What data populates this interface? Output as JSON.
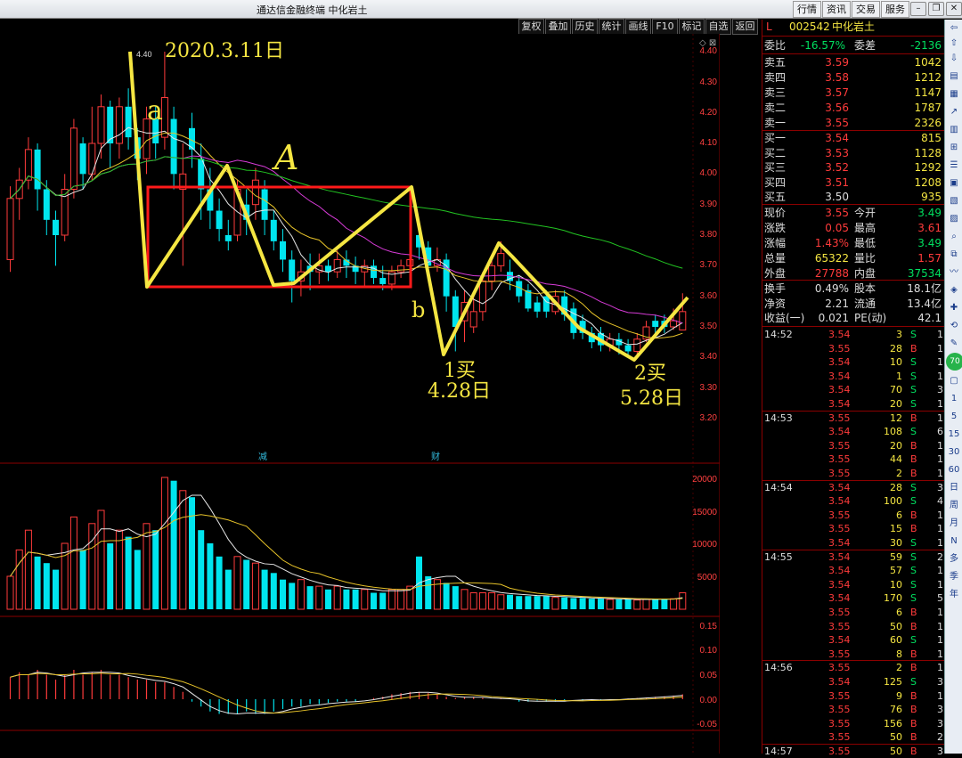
{
  "window": {
    "title": "通达信金融终端  中化岩土",
    "menu": [
      "行情",
      "资讯",
      "交易",
      "服务"
    ]
  },
  "chart_toolbar": [
    "复权",
    "叠加",
    "历史",
    "统计",
    "画线",
    "F10",
    "标记",
    "自选",
    "返回"
  ],
  "price_axis": [
    "4.40",
    "4.30",
    "4.20",
    "4.10",
    "4.00",
    "3.90",
    "3.80",
    "3.70",
    "3.60",
    "3.50",
    "3.40",
    "3.30",
    "3.20"
  ],
  "volume_axis": [
    "20000",
    "15000",
    "10000",
    "5000"
  ],
  "macd_axis": [
    "0.15",
    "0.10",
    "0.05",
    "0.00",
    "-0.05"
  ],
  "chart_labels": {
    "high_mark": "4.40",
    "marker_jian": "减",
    "marker_cai": "财"
  },
  "annotations": {
    "date_top": "2020.3.11日",
    "a": "a",
    "box": "A",
    "b": "b",
    "buy1": "1买",
    "date1": "4.28日",
    "buy2": "2买",
    "date2": "5.28日"
  },
  "stock": {
    "flag": "L",
    "code": "002542",
    "name": "中化岩土"
  },
  "quote": {
    "weibi_label": "委比",
    "weibi": "-16.57%",
    "weicha_label": "委差",
    "weicha": "-2136",
    "asks": [
      {
        "label": "卖五",
        "price": "3.59",
        "vol": "1042"
      },
      {
        "label": "卖四",
        "price": "3.58",
        "vol": "1212"
      },
      {
        "label": "卖三",
        "price": "3.57",
        "vol": "1147"
      },
      {
        "label": "卖二",
        "price": "3.56",
        "vol": "1787"
      },
      {
        "label": "卖一",
        "price": "3.55",
        "vol": "2326"
      }
    ],
    "bids": [
      {
        "label": "买一",
        "price": "3.54",
        "vol": "815"
      },
      {
        "label": "买二",
        "price": "3.53",
        "vol": "1128"
      },
      {
        "label": "买三",
        "price": "3.52",
        "vol": "1292"
      },
      {
        "label": "买四",
        "price": "3.51",
        "vol": "1208"
      },
      {
        "label": "买五",
        "price": "3.50",
        "vol": "935"
      }
    ],
    "stats": [
      {
        "l1": "现价",
        "v1": "3.55",
        "l2": "今开",
        "v2": "3.49"
      },
      {
        "l1": "涨跌",
        "v1": "0.05",
        "l2": "最高",
        "v2": "3.61"
      },
      {
        "l1": "涨幅",
        "v1": "1.43%",
        "l2": "最低",
        "v2": "3.49"
      },
      {
        "l1": "总量",
        "v1": "65322",
        "l2": "量比",
        "v2": "1.57"
      },
      {
        "l1": "外盘",
        "v1": "27788",
        "l2": "内盘",
        "v2": "37534"
      }
    ],
    "stats2": [
      {
        "l1": "换手",
        "v1": "0.49%",
        "l2": "股本",
        "v2": "18.1亿"
      },
      {
        "l1": "净资",
        "v1": "2.21",
        "l2": "流通",
        "v2": "13.4亿"
      },
      {
        "l1": "收益(一)",
        "v1": "0.021",
        "l2": "PE(动)",
        "v2": "42.1"
      }
    ]
  },
  "ticks": [
    {
      "time": "14:52",
      "price": "3.54",
      "vol": "3",
      "side": "S",
      "n": "1"
    },
    {
      "time": "",
      "price": "3.55",
      "vol": "28",
      "side": "B",
      "n": "1"
    },
    {
      "time": "",
      "price": "3.54",
      "vol": "10",
      "side": "S",
      "n": "1"
    },
    {
      "time": "",
      "price": "3.54",
      "vol": "1",
      "side": "S",
      "n": "1"
    },
    {
      "time": "",
      "price": "3.54",
      "vol": "70",
      "side": "S",
      "n": "3"
    },
    {
      "time": "",
      "price": "3.54",
      "vol": "20",
      "side": "S",
      "n": "1"
    },
    {
      "time": "14:53",
      "price": "3.55",
      "vol": "12",
      "side": "B",
      "n": "1"
    },
    {
      "time": "",
      "price": "3.54",
      "vol": "108",
      "side": "S",
      "n": "6"
    },
    {
      "time": "",
      "price": "3.55",
      "vol": "20",
      "side": "B",
      "n": "1"
    },
    {
      "time": "",
      "price": "3.55",
      "vol": "44",
      "side": "B",
      "n": "1"
    },
    {
      "time": "",
      "price": "3.55",
      "vol": "2",
      "side": "B",
      "n": "1"
    },
    {
      "time": "14:54",
      "price": "3.54",
      "vol": "28",
      "side": "S",
      "n": "3"
    },
    {
      "time": "",
      "price": "3.54",
      "vol": "100",
      "side": "S",
      "n": "4"
    },
    {
      "time": "",
      "price": "3.55",
      "vol": "6",
      "side": "B",
      "n": "1"
    },
    {
      "time": "",
      "price": "3.55",
      "vol": "15",
      "side": "B",
      "n": "1"
    },
    {
      "time": "",
      "price": "3.54",
      "vol": "30",
      "side": "S",
      "n": "1"
    },
    {
      "time": "14:55",
      "price": "3.54",
      "vol": "59",
      "side": "S",
      "n": "2"
    },
    {
      "time": "",
      "price": "3.54",
      "vol": "57",
      "side": "S",
      "n": "1"
    },
    {
      "time": "",
      "price": "3.54",
      "vol": "10",
      "side": "S",
      "n": "1"
    },
    {
      "time": "",
      "price": "3.54",
      "vol": "170",
      "side": "S",
      "n": "5"
    },
    {
      "time": "",
      "price": "3.55",
      "vol": "6",
      "side": "B",
      "n": "1"
    },
    {
      "time": "",
      "price": "3.55",
      "vol": "50",
      "side": "B",
      "n": "1"
    },
    {
      "time": "",
      "price": "3.54",
      "vol": "60",
      "side": "S",
      "n": "1"
    },
    {
      "time": "",
      "price": "3.55",
      "vol": "8",
      "side": "B",
      "n": "1"
    },
    {
      "time": "14:56",
      "price": "3.55",
      "vol": "2",
      "side": "B",
      "n": "1"
    },
    {
      "time": "",
      "price": "3.54",
      "vol": "125",
      "side": "S",
      "n": "3"
    },
    {
      "time": "",
      "price": "3.55",
      "vol": "9",
      "side": "B",
      "n": "1"
    },
    {
      "time": "",
      "price": "3.55",
      "vol": "76",
      "side": "B",
      "n": "3"
    },
    {
      "time": "",
      "price": "3.55",
      "vol": "156",
      "side": "B",
      "n": "3"
    },
    {
      "time": "",
      "price": "3.55",
      "vol": "50",
      "side": "B",
      "n": "2"
    },
    {
      "time": "14:57",
      "price": "3.55",
      "vol": "50",
      "side": "B",
      "n": "3"
    }
  ],
  "side_toolbar": [
    "1",
    "5",
    "15",
    "30",
    "60",
    "日",
    "周",
    "月",
    "N",
    "多",
    "季",
    "年"
  ],
  "side_badge": "70",
  "colors": {
    "up": "#ff3b3b",
    "down": "#00e5ee",
    "accent": "#f5e642",
    "panel_border": "#8b0000"
  },
  "chart_data": {
    "type": "candlestick",
    "ylim": [
      3.15,
      4.45
    ],
    "candles": [
      {
        "o": 3.72,
        "c": 3.92,
        "h": 3.96,
        "l": 3.68
      },
      {
        "o": 3.92,
        "c": 3.98,
        "h": 4.02,
        "l": 3.85
      },
      {
        "o": 3.98,
        "c": 4.08,
        "h": 4.12,
        "l": 3.95
      },
      {
        "o": 4.08,
        "c": 3.95,
        "h": 4.1,
        "l": 3.88
      },
      {
        "o": 3.95,
        "c": 3.85,
        "h": 3.98,
        "l": 3.8
      },
      {
        "o": 3.85,
        "c": 3.8,
        "h": 3.88,
        "l": 3.7
      },
      {
        "o": 3.8,
        "c": 3.95,
        "h": 4.0,
        "l": 3.78
      },
      {
        "o": 3.95,
        "c": 4.15,
        "h": 4.18,
        "l": 3.92
      },
      {
        "o": 4.1,
        "c": 4.0,
        "h": 4.12,
        "l": 3.95
      },
      {
        "o": 4.0,
        "c": 4.1,
        "h": 4.22,
        "l": 3.98
      },
      {
        "o": 4.1,
        "c": 4.22,
        "h": 4.26,
        "l": 4.05
      },
      {
        "o": 4.22,
        "c": 4.1,
        "h": 4.24,
        "l": 4.02
      },
      {
        "o": 4.1,
        "c": 4.22,
        "h": 4.25,
        "l": 4.05
      },
      {
        "o": 4.22,
        "c": 4.12,
        "h": 4.28,
        "l": 4.08
      },
      {
        "o": 4.12,
        "c": 4.05,
        "h": 4.15,
        "l": 3.98
      },
      {
        "o": 4.05,
        "c": 4.18,
        "h": 4.22,
        "l": 4.0
      },
      {
        "o": 4.18,
        "c": 4.1,
        "h": 4.22,
        "l": 4.05
      },
      {
        "o": 4.12,
        "c": 4.25,
        "h": 4.4,
        "l": 4.08
      },
      {
        "o": 4.18,
        "c": 4.0,
        "h": 4.22,
        "l": 3.95
      },
      {
        "o": 3.95,
        "c": 4.0,
        "h": 4.1,
        "l": 3.7
      },
      {
        "o": 4.15,
        "c": 4.08,
        "h": 4.2,
        "l": 4.02
      },
      {
        "o": 4.05,
        "c": 3.95,
        "h": 4.1,
        "l": 3.85
      },
      {
        "o": 3.95,
        "c": 3.88,
        "h": 4.02,
        "l": 3.82
      },
      {
        "o": 3.88,
        "c": 3.82,
        "h": 3.92,
        "l": 3.78
      },
      {
        "o": 3.8,
        "c": 3.78,
        "h": 3.85,
        "l": 3.75
      },
      {
        "o": 3.8,
        "c": 3.95,
        "h": 3.98,
        "l": 3.78
      },
      {
        "o": 3.9,
        "c": 3.85,
        "h": 3.95,
        "l": 3.8
      },
      {
        "o": 3.9,
        "c": 3.98,
        "h": 4.02,
        "l": 3.85
      },
      {
        "o": 3.95,
        "c": 3.85,
        "h": 3.98,
        "l": 3.8
      },
      {
        "o": 3.85,
        "c": 3.78,
        "h": 3.88,
        "l": 3.75
      },
      {
        "o": 3.78,
        "c": 3.72,
        "h": 3.82,
        "l": 3.68
      },
      {
        "o": 3.72,
        "c": 3.65,
        "h": 3.75,
        "l": 3.58
      },
      {
        "o": 3.65,
        "c": 3.68,
        "h": 3.72,
        "l": 3.6
      },
      {
        "o": 3.7,
        "c": 3.68,
        "h": 3.74,
        "l": 3.62
      },
      {
        "o": 3.68,
        "c": 3.7,
        "h": 3.74,
        "l": 3.64
      },
      {
        "o": 3.7,
        "c": 3.68,
        "h": 3.72,
        "l": 3.65
      },
      {
        "o": 3.68,
        "c": 3.72,
        "h": 3.75,
        "l": 3.66
      },
      {
        "o": 3.72,
        "c": 3.7,
        "h": 3.75,
        "l": 3.66
      },
      {
        "o": 3.7,
        "c": 3.68,
        "h": 3.73,
        "l": 3.64
      },
      {
        "o": 3.68,
        "c": 3.7,
        "h": 3.72,
        "l": 3.63
      },
      {
        "o": 3.7,
        "c": 3.66,
        "h": 3.72,
        "l": 3.64
      },
      {
        "o": 3.66,
        "c": 3.64,
        "h": 3.7,
        "l": 3.62
      },
      {
        "o": 3.64,
        "c": 3.68,
        "h": 3.7,
        "l": 3.62
      },
      {
        "o": 3.68,
        "c": 3.7,
        "h": 3.72,
        "l": 3.66
      },
      {
        "o": 3.7,
        "c": 3.72,
        "h": 3.76,
        "l": 3.68
      },
      {
        "o": 3.8,
        "c": 3.76,
        "h": 3.84,
        "l": 3.72
      },
      {
        "o": 3.76,
        "c": 3.7,
        "h": 3.78,
        "l": 3.66
      },
      {
        "o": 3.7,
        "c": 3.72,
        "h": 3.76,
        "l": 3.68
      },
      {
        "o": 3.72,
        "c": 3.6,
        "h": 3.74,
        "l": 3.55
      },
      {
        "o": 3.6,
        "c": 3.5,
        "h": 3.62,
        "l": 3.42
      },
      {
        "o": 3.52,
        "c": 3.58,
        "h": 3.62,
        "l": 3.45
      },
      {
        "o": 3.5,
        "c": 3.55,
        "h": 3.6,
        "l": 3.48
      },
      {
        "o": 3.55,
        "c": 3.65,
        "h": 3.68,
        "l": 3.52
      },
      {
        "o": 3.65,
        "c": 3.7,
        "h": 3.72,
        "l": 3.62
      },
      {
        "o": 3.7,
        "c": 3.74,
        "h": 3.78,
        "l": 3.68
      },
      {
        "o": 3.68,
        "c": 3.65,
        "h": 3.72,
        "l": 3.62
      },
      {
        "o": 3.65,
        "c": 3.6,
        "h": 3.67,
        "l": 3.58
      },
      {
        "o": 3.62,
        "c": 3.56,
        "h": 3.64,
        "l": 3.55
      },
      {
        "o": 3.58,
        "c": 3.55,
        "h": 3.6,
        "l": 3.53
      },
      {
        "o": 3.6,
        "c": 3.55,
        "h": 3.62,
        "l": 3.53
      },
      {
        "o": 3.55,
        "c": 3.6,
        "h": 3.62,
        "l": 3.54
      },
      {
        "o": 3.6,
        "c": 3.54,
        "h": 3.62,
        "l": 3.52
      },
      {
        "o": 3.56,
        "c": 3.48,
        "h": 3.58,
        "l": 3.46
      },
      {
        "o": 3.52,
        "c": 3.48,
        "h": 3.54,
        "l": 3.46
      },
      {
        "o": 3.48,
        "c": 3.45,
        "h": 3.5,
        "l": 3.43
      },
      {
        "o": 3.48,
        "c": 3.44,
        "h": 3.5,
        "l": 3.42
      },
      {
        "o": 3.44,
        "c": 3.46,
        "h": 3.48,
        "l": 3.42
      },
      {
        "o": 3.46,
        "c": 3.44,
        "h": 3.48,
        "l": 3.41
      },
      {
        "o": 3.44,
        "c": 3.42,
        "h": 3.46,
        "l": 3.4
      },
      {
        "o": 3.42,
        "c": 3.46,
        "h": 3.48,
        "l": 3.4
      },
      {
        "o": 3.46,
        "c": 3.5,
        "h": 3.52,
        "l": 3.45
      },
      {
        "o": 3.52,
        "c": 3.5,
        "h": 3.54,
        "l": 3.48
      },
      {
        "o": 3.52,
        "c": 3.5,
        "h": 3.54,
        "l": 3.48
      },
      {
        "o": 3.5,
        "c": 3.52,
        "h": 3.56,
        "l": 3.49
      },
      {
        "o": 3.49,
        "c": 3.55,
        "h": 3.61,
        "l": 3.49
      }
    ],
    "volume": [
      5000,
      9000,
      12000,
      8000,
      7000,
      6000,
      10000,
      14000,
      9000,
      13000,
      15000,
      10000,
      12000,
      11000,
      9000,
      13000,
      12000,
      20000,
      19500,
      18000,
      17000,
      12000,
      10000,
      8000,
      6000,
      8000,
      7500,
      7000,
      6000,
      5500,
      4500,
      4000,
      4500,
      3500,
      3500,
      3000,
      3500,
      3000,
      3000,
      3000,
      2500,
      2500,
      3000,
      3000,
      3500,
      8000,
      5000,
      4500,
      4000,
      3500,
      3000,
      2500,
      2500,
      2500,
      2200,
      2200,
      2000,
      2000,
      2000,
      2000,
      1800,
      1800,
      1700,
      1700,
      1600,
      1600,
      1500,
      1500,
      1500,
      1400,
      1500,
      1600,
      1600,
      1600,
      2500
    ],
    "macd": [
      0.09,
      0.11,
      0.1,
      0.12,
      0.1,
      0.08,
      0.1,
      0.12,
      0.1,
      0.11,
      0.12,
      0.1,
      0.1,
      0.09,
      0.08,
      0.08,
      0.07,
      0.07,
      0.05,
      0.03,
      -0.01,
      -0.03,
      -0.05,
      -0.06,
      -0.06,
      -0.06,
      -0.05,
      -0.06,
      -0.06,
      -0.05,
      -0.04,
      -0.03,
      -0.03,
      -0.02,
      -0.02,
      -0.015,
      -0.01,
      -0.01,
      -0.01,
      0.0,
      0.005,
      0.01,
      0.02,
      0.025,
      0.03,
      0.03,
      0.025,
      0.02,
      0.01,
      0.005,
      0.01,
      0.01,
      0.005,
      0.0,
      0.005,
      0.0,
      -0.01,
      -0.01,
      -0.005,
      -0.01,
      -0.01,
      -0.005,
      0.0,
      -0.005,
      0.0,
      -0.005,
      0.0,
      0.0,
      0.003,
      0.005,
      0.007,
      0.01,
      0.012,
      0.015,
      0.02
    ]
  }
}
